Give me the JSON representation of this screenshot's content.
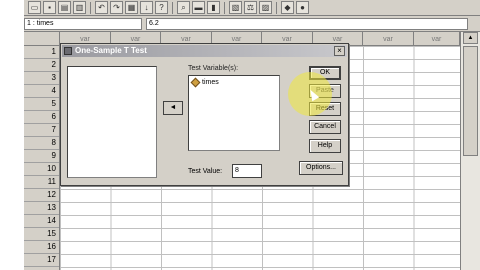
{
  "cell_editor": {
    "reference": "1 : times",
    "value": "6.2"
  },
  "toolbar": {
    "icons": [
      "open-icon",
      "save-icon",
      "print-icon",
      "dialog-recall-icon",
      "undo-icon",
      "redo-icon",
      "goto-chart-icon",
      "goto-case-icon",
      "variables-icon",
      "find-icon",
      "insert-cases-icon",
      "insert-variable-icon",
      "split-file-icon",
      "weight-cases-icon",
      "select-cases-icon",
      "value-labels-icon",
      "use-sets-icon"
    ]
  },
  "grid": {
    "column_headers": [
      "var",
      "var",
      "var",
      "var",
      "var",
      "var",
      "var",
      "var"
    ],
    "row_numbers": [
      "1",
      "2",
      "3",
      "4",
      "5",
      "6",
      "7",
      "8",
      "9",
      "10",
      "11",
      "12",
      "13",
      "14",
      "15",
      "16",
      "17"
    ]
  },
  "dialog": {
    "title": "One-Sample T Test",
    "move_button": "◄",
    "test_variables_label": "Test Variable(s):",
    "test_variables": [
      "times"
    ],
    "test_value_label": "Test Value:",
    "test_value": "8",
    "buttons": {
      "ok": "OK",
      "paste": "Paste",
      "reset": "Reset",
      "cancel": "Cancel",
      "help": "Help",
      "options": "Options..."
    }
  },
  "colors": {
    "chrome": "#d4d0c8",
    "highlight": "#eee83c"
  }
}
